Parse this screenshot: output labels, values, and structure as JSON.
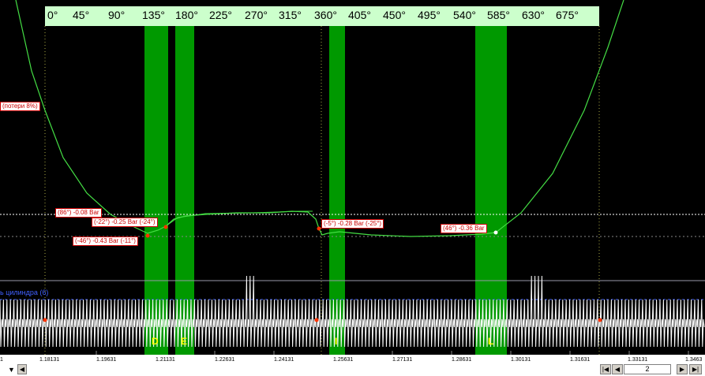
{
  "degree_ticks": [
    "0°",
    "45°",
    "90°",
    "135°",
    "180°",
    "225°",
    "270°",
    "315°",
    "360°",
    "405°",
    "450°",
    "495°",
    "540°",
    "585°",
    "630°",
    "675°"
  ],
  "annotations": {
    "loss": "(потери 8%)",
    "a1": "(86°) -0.08 Bar",
    "a2": "(-22°) -0.25 Bar (-24°)",
    "a3": "(-46°) -0.43 Bar (-11°)",
    "a4": "(-5°) -0.28 Bar (-25°)",
    "a5": "(46°) -0.36 Bar"
  },
  "cylinder_label": "ь цилиндра (6)",
  "zone_letters": [
    "D",
    "E",
    "I",
    "L"
  ],
  "time_axis": [
    "1",
    "1.18131",
    "1.19631",
    "1.21131",
    "1.22631",
    "1.24131",
    "1.25631",
    "1.27131",
    "1.28631",
    "1.30131",
    "1.31631",
    "1.33131",
    "1.3463"
  ],
  "pager": {
    "page": "2",
    "first": "|◀",
    "prev": "◀",
    "next": "▶",
    "last": "▶|",
    "scroll_left": "◀",
    "dropdown": "▼"
  },
  "colors": {
    "background": "#000000",
    "trace": "#44dd44",
    "zone": "#009900",
    "header_bar": "#ccffcc",
    "annotation": "#cc0000",
    "lower_trace": "#ffffff"
  }
}
